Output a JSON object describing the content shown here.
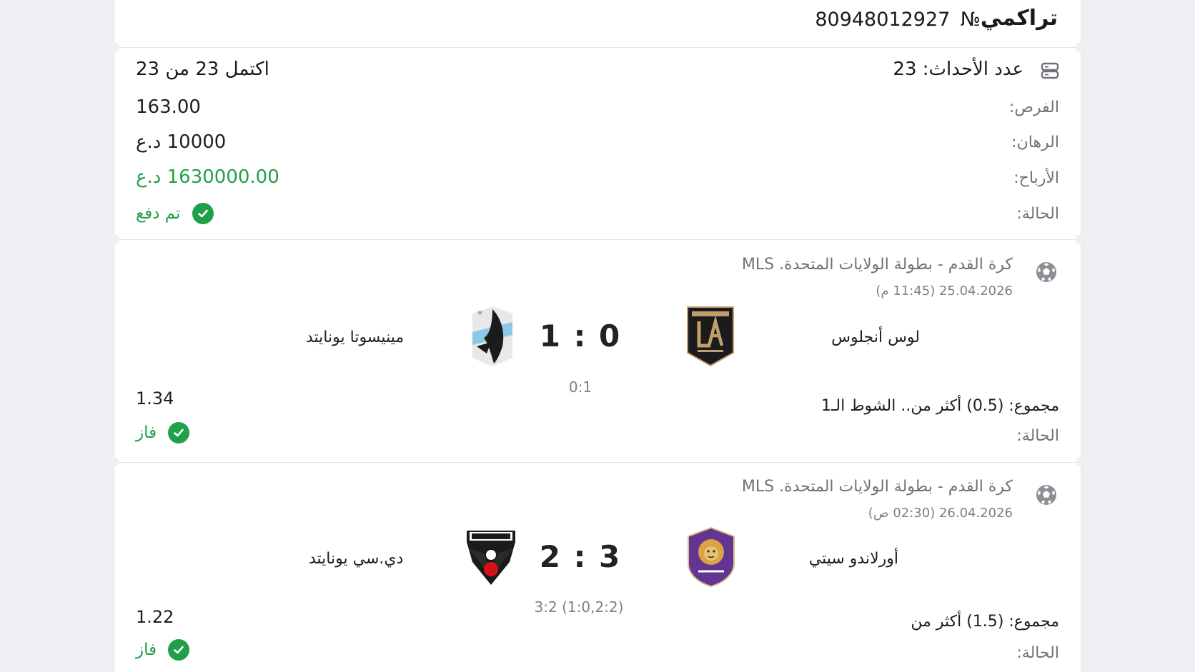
{
  "header": {
    "title": "تراكمي",
    "number_prefix": "№",
    "number": "80948012927"
  },
  "summary": {
    "events_label": "عدد الأحداث: 23",
    "completed": "اكتمل 23 من 23",
    "rows": [
      {
        "label": "الفرص:",
        "value": "163.00"
      },
      {
        "label": "الرهان:",
        "value": "10000 د.ع"
      },
      {
        "label": "الأرباح:",
        "value": "1630000.00 د.ع"
      },
      {
        "label": "الحالة:",
        "value": "تم دفع"
      }
    ]
  },
  "events": [
    {
      "league": "كرة القدم - بطولة الولايات المتحدة. MLS",
      "datetime": "25.04.2026 (11:45 م)",
      "home_team": "لوس أنجلوس",
      "away_team": "مينيسوتا يونايتد",
      "score": "1 : 0",
      "subscore": "0:1",
      "market": "مجموع: (0.5) أكثر من.. الشوط الـ1",
      "odd": "1.34",
      "status_label": "الحالة:",
      "status": "فاز",
      "home_logo_text": "LAFC",
      "away_logo_text": "MNUFC"
    },
    {
      "league": "كرة القدم - بطولة الولايات المتحدة. MLS",
      "datetime": "26.04.2026 (02:30 ص)",
      "home_team": "أورلاندو سيتي",
      "away_team": "دي.سي يونايتد",
      "score": "2 : 3",
      "subscore": "3:2 (1:0,2:2)",
      "market": "مجموع: (1.5) أكثر من",
      "odd": "1.22",
      "status_label": "الحالة:",
      "status": "فاز",
      "home_logo_text": "ORLANDO CITY",
      "away_logo_text": "DC UNITED"
    }
  ],
  "colors": {
    "win_green": "#21a04a",
    "background": "#eef0f3",
    "card": "#ffffff",
    "lafc_gold": "#c39e6d",
    "orlando_purple": "#633492",
    "dc_red": "#d61018"
  }
}
